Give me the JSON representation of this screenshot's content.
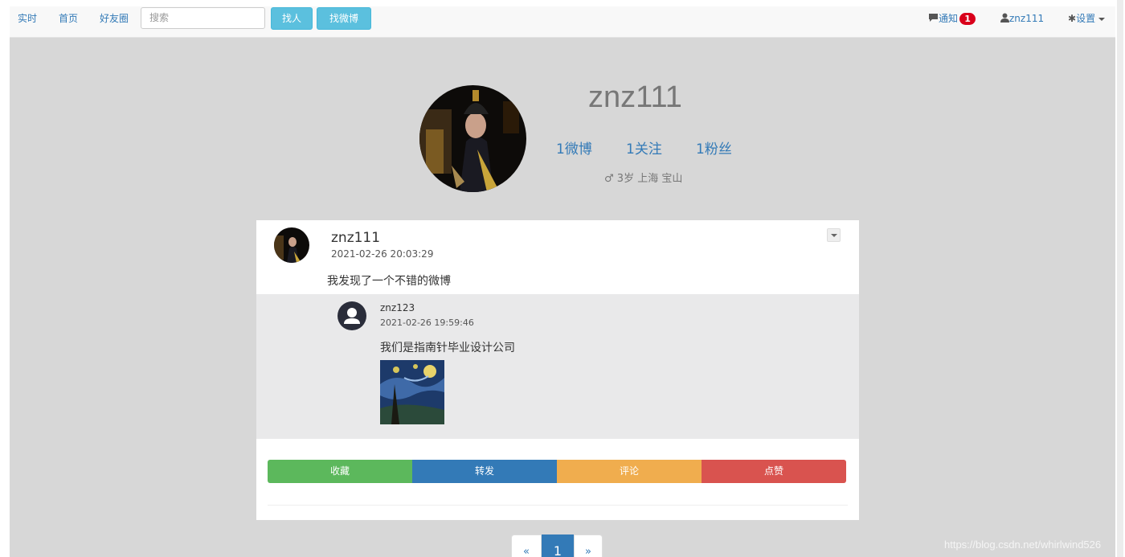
{
  "navbar": {
    "links": [
      "实时",
      "首页",
      "好友圈"
    ],
    "search_placeholder": "搜索",
    "find_people": "找人",
    "find_weibo": "找微博",
    "notify_label": "通知",
    "notify_count": "1",
    "user_label": "znz111",
    "settings_label": "设置"
  },
  "profile": {
    "name": "znz111",
    "stats": [
      "1微博",
      "1关注",
      "1粉丝"
    ],
    "info": "3岁 上海 宝山"
  },
  "post": {
    "user": "znz111",
    "time": "2021-02-26 20:03:29",
    "text": "我发现了一个不错的微博",
    "repost": {
      "user": "znz123",
      "time": "2021-02-26 19:59:46",
      "text": "我们是指南针毕业设计公司"
    },
    "actions": [
      {
        "label": "收藏",
        "color": "#5cb85c"
      },
      {
        "label": "转发",
        "color": "#337ab7"
      },
      {
        "label": "评论",
        "color": "#f0ad4e"
      },
      {
        "label": "点赞",
        "color": "#d9534f"
      }
    ]
  },
  "pagination": {
    "prev": "«",
    "current": "1",
    "next": "»"
  },
  "watermark": "https://blog.csdn.net/whirlwind526"
}
